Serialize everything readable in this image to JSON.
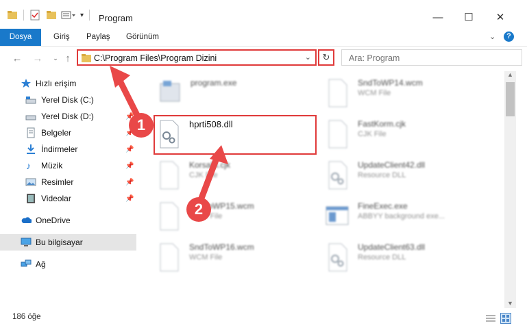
{
  "window": {
    "title": "Program",
    "controls": {
      "minimize": "—",
      "maximize": "☐",
      "close": "✕"
    },
    "help": "?"
  },
  "ribbon": {
    "tabs": [
      "Dosya",
      "Giriş",
      "Paylaş",
      "Görünüm"
    ]
  },
  "address": {
    "path": "C:\\Program Files\\Program Dizini"
  },
  "search": {
    "placeholder": "Ara: Program"
  },
  "sidebar": {
    "quick_access": "Hızlı erişim",
    "items": [
      {
        "label": "Yerel Disk (C:)",
        "pinned": false
      },
      {
        "label": "Yerel Disk (D:)",
        "pinned": true
      },
      {
        "label": "Belgeler",
        "pinned": true
      },
      {
        "label": "İndirmeler",
        "pinned": true
      },
      {
        "label": "Müzik",
        "pinned": true
      },
      {
        "label": "Resimler",
        "pinned": true
      },
      {
        "label": "Videolar",
        "pinned": true
      }
    ],
    "onedrive": "OneDrive",
    "this_pc": "Bu bilgisayar",
    "network": "Ağ"
  },
  "files": [
    {
      "name": "program.exe",
      "type": ""
    },
    {
      "name": "SndToWP14.wcm",
      "type": "WCM File"
    },
    {
      "name": "hprti508.dll",
      "type": ""
    },
    {
      "name": "FastKorm.cjk",
      "type": "CJK File"
    },
    {
      "name": "KorsaBl.cjk",
      "type": "CJK File"
    },
    {
      "name": "UpdateClient42.dll",
      "type": "Resource DLL"
    },
    {
      "name": "SndToWP15.wcm",
      "type": "WCM File"
    },
    {
      "name": "FineExec.exe",
      "type": "ABBYY background exe..."
    },
    {
      "name": "SndToWP16.wcm",
      "type": "WCM File"
    },
    {
      "name": "UpdateClient63.dll",
      "type": "Resource DLL"
    }
  ],
  "annotations": {
    "step1": "1",
    "step2": "2"
  },
  "status": {
    "count": "186 öğe"
  }
}
